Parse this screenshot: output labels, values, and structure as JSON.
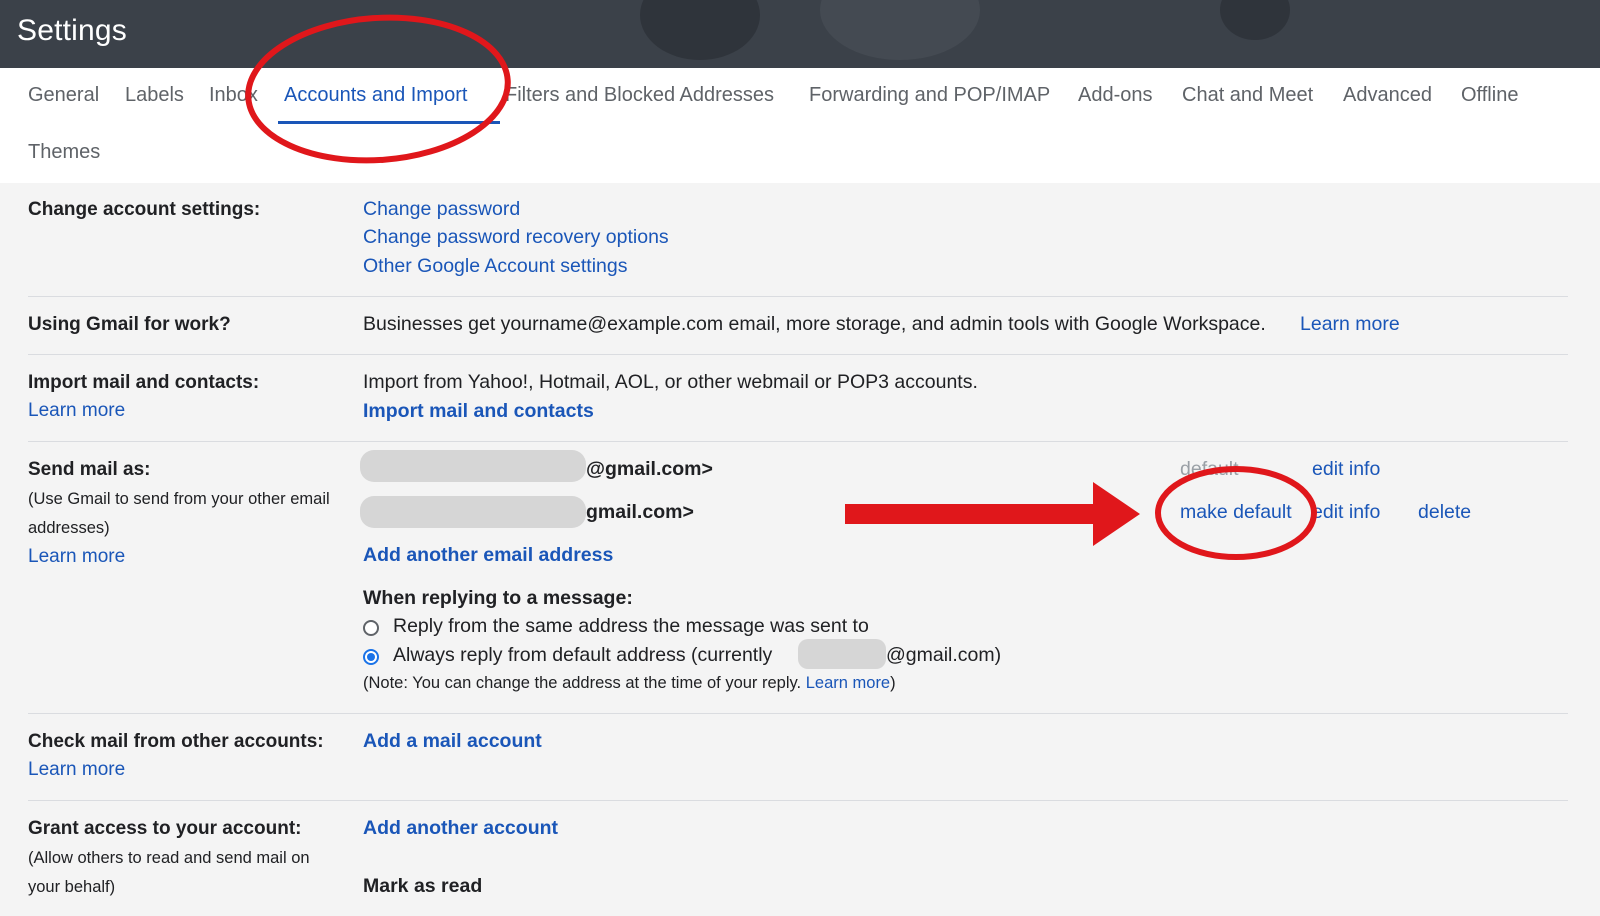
{
  "header": {
    "title": "Settings"
  },
  "tabs": [
    {
      "label": "General"
    },
    {
      "label": "Labels"
    },
    {
      "label": "Inbox"
    },
    {
      "label": "Accounts and Import"
    },
    {
      "label": "Filters and Blocked Addresses"
    },
    {
      "label": "Forwarding and POP/IMAP"
    },
    {
      "label": "Add-ons"
    },
    {
      "label": "Chat and Meet"
    },
    {
      "label": "Advanced"
    },
    {
      "label": "Offline"
    },
    {
      "label": "Themes"
    }
  ],
  "active_tab": "Accounts and Import",
  "sections": {
    "change_account": {
      "label": "Change account settings:",
      "links": [
        "Change password",
        "Change password recovery options",
        "Other Google Account settings"
      ]
    },
    "work": {
      "label": "Using Gmail for work?",
      "text": "Businesses get yourname@example.com email, more storage, and admin tools with Google Workspace.",
      "link": "Learn more"
    },
    "import": {
      "label": "Import mail and contacts:",
      "learn_more": "Learn more",
      "text": "Import from Yahoo!, Hotmail, AOL, or other webmail or POP3 accounts.",
      "action": "Import mail and contacts"
    },
    "send_as": {
      "label": "Send mail as:",
      "sub1": "(Use Gmail to send from your other email",
      "sub2": "addresses)",
      "learn_more": "Learn more",
      "addresses": [
        {
          "suffix": "@gmail.com>",
          "status": "default",
          "edit": "edit info"
        },
        {
          "suffix": "gmail.com>",
          "make_default": "make default",
          "edit": "edit info",
          "delete": "delete"
        }
      ],
      "add": "Add another email address",
      "reply_heading": "When replying to a message:",
      "reply_option_1": "Reply from the same address the message was sent to",
      "reply_option_2_prefix": "Always reply from default address (currently",
      "reply_option_2_suffix": "@gmail.com)",
      "note_prefix": "(Note: You can change the address at the time of your reply.",
      "note_link": "Learn more",
      "note_suffix": ")"
    },
    "check_mail": {
      "label": "Check mail from other accounts:",
      "learn_more": "Learn more",
      "action": "Add a mail account"
    },
    "grant": {
      "label": "Grant access to your account:",
      "sub1": "(Allow others to read and send mail on",
      "sub2": "your behalf)",
      "action": "Add another account",
      "mark_as_read": "Mark as read"
    }
  },
  "annotations": {
    "color": "#e0171b"
  }
}
